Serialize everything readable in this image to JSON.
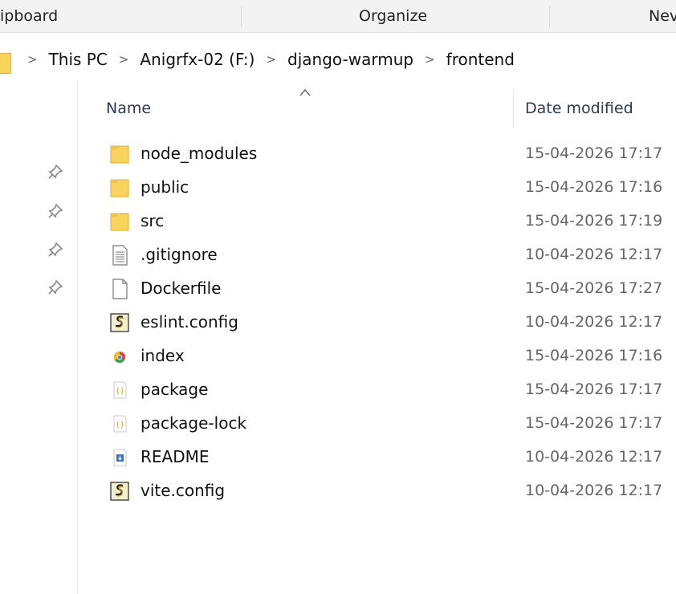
{
  "ribbon": {
    "groups": [
      "ipboard",
      "Organize",
      "Nev"
    ]
  },
  "address": {
    "crumbs": [
      "This PC",
      "Anigrfx-02 (F:)",
      "django-warmup",
      "frontend"
    ],
    "separator": ">"
  },
  "columns": {
    "name": "Name",
    "date_modified": "Date modified"
  },
  "files": [
    {
      "name": "node_modules",
      "date": "15-04-2026 17:17",
      "icon": "folder-icon"
    },
    {
      "name": "public",
      "date": "15-04-2026 17:16",
      "icon": "folder-icon"
    },
    {
      "name": "src",
      "date": "15-04-2026 17:19",
      "icon": "folder-icon"
    },
    {
      "name": ".gitignore",
      "date": "10-04-2026 12:17",
      "icon": "text-file-icon"
    },
    {
      "name": "Dockerfile",
      "date": "15-04-2026 17:27",
      "icon": "blank-file-icon"
    },
    {
      "name": "eslint.config",
      "date": "10-04-2026 12:17",
      "icon": "script-file-icon"
    },
    {
      "name": "index",
      "date": "15-04-2026 17:16",
      "icon": "chrome-html-icon"
    },
    {
      "name": "package",
      "date": "15-04-2026 17:17",
      "icon": "json-file-icon"
    },
    {
      "name": "package-lock",
      "date": "15-04-2026 17:17",
      "icon": "json-file-icon"
    },
    {
      "name": "README",
      "date": "10-04-2026 12:17",
      "icon": "markdown-file-icon"
    },
    {
      "name": "vite.config",
      "date": "10-04-2026 12:17",
      "icon": "script-file-icon"
    }
  ],
  "quick_access_pins": 4
}
